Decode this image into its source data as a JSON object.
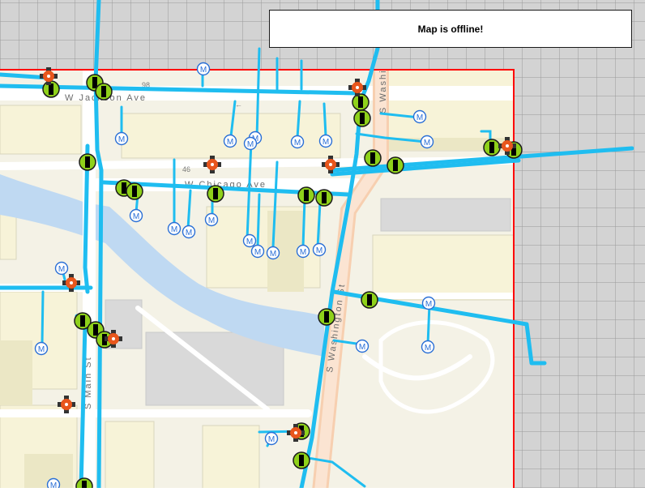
{
  "banner": {
    "message": "Map is offline!"
  },
  "streets": {
    "jackson": "W Jackson Ave",
    "chicago": "W Chicago Ave",
    "washington_top": "S Washi",
    "washington": "S Washington St",
    "main": "S Main St"
  },
  "road_numbers": {
    "r98": "98",
    "r46": "46"
  },
  "icons": {
    "meter": "meter-icon",
    "valve": "valve-icon",
    "hydrant": "hydrant-icon"
  },
  "meter_letter": "M",
  "arrow_glyph": "←",
  "colors": {
    "pipe": "#1fbdf0",
    "extent": "#ff0000",
    "valve_fill": "#8fd11a",
    "hydrant": "#e8561c",
    "meter": "#2a6fd6",
    "grid_bg": "#d3d3d3"
  }
}
